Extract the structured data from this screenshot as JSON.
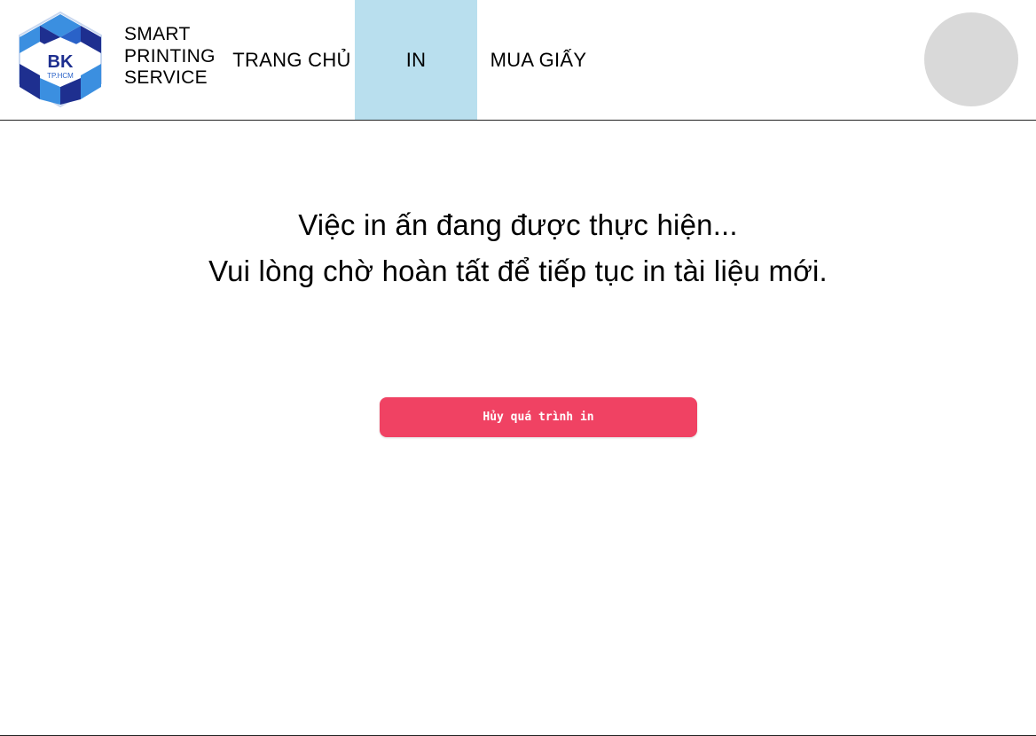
{
  "header": {
    "logo": {
      "text": "BK",
      "subtext": "TP.HCM",
      "colors": {
        "dark": "#1e2f8f",
        "light": "#3b8fe0",
        "mid": "#2a62c8"
      }
    },
    "brand": {
      "line1": "SMART",
      "line2": "PRINTING",
      "line3": "SERVICE"
    },
    "nav": {
      "home": "TRANG CHỦ",
      "print": "IN",
      "buy_paper": "MUA GIẤY"
    },
    "active_nav": "IN",
    "active_color": "#b9dfee"
  },
  "main": {
    "message_line1": "Việc in ấn đang được thực hiện...",
    "message_line2": "Vui lòng chờ hoàn tất để tiếp tục in tài liệu mới.",
    "cancel_button": "Hủy quá trình in",
    "cancel_color": "#f04263"
  }
}
